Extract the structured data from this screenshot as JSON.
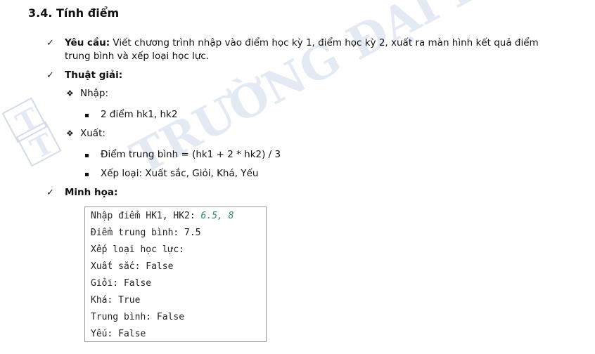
{
  "section": {
    "number": "3.4.",
    "title": "Tính điểm"
  },
  "watermark": {
    "text": "TRƯỜNG ĐẠI HỌC ... TRUNG TÂM"
  },
  "requirement": {
    "label": "Yêu cầu:",
    "text_line1": "Viết chương trình nhập vào điểm học kỳ 1, điểm học kỳ 2, xuất ra màn hình kết quả điểm",
    "text_line2": "trung bình và xếp loại học lực."
  },
  "algorithm": {
    "label": "Thuật giải:",
    "input_label": "Nhập:",
    "input_item": "2 điểm hk1, hk2",
    "output_label": "Xuất:",
    "output_items": [
      "Điểm trung bình = (hk1 + 2 * hk2) / 3",
      "Xếp loại: Xuất sắc, Giỏi, Khá, Yếu"
    ]
  },
  "illustration": {
    "label": "Minh họa:",
    "console": {
      "prompt": "Nhập điểm HK1, HK2: ",
      "input_value": "6.5, 8",
      "lines": [
        "Điểm trung bình: 7.5",
        "Xếp loại học lực:",
        "Xuất sắc: False",
        "Giỏi: False",
        "Khá: True",
        "Trung bình: False",
        "Yếu: False"
      ]
    }
  },
  "colors": {
    "console_input": "#2e8b57",
    "watermark": "#cfd8e6"
  }
}
